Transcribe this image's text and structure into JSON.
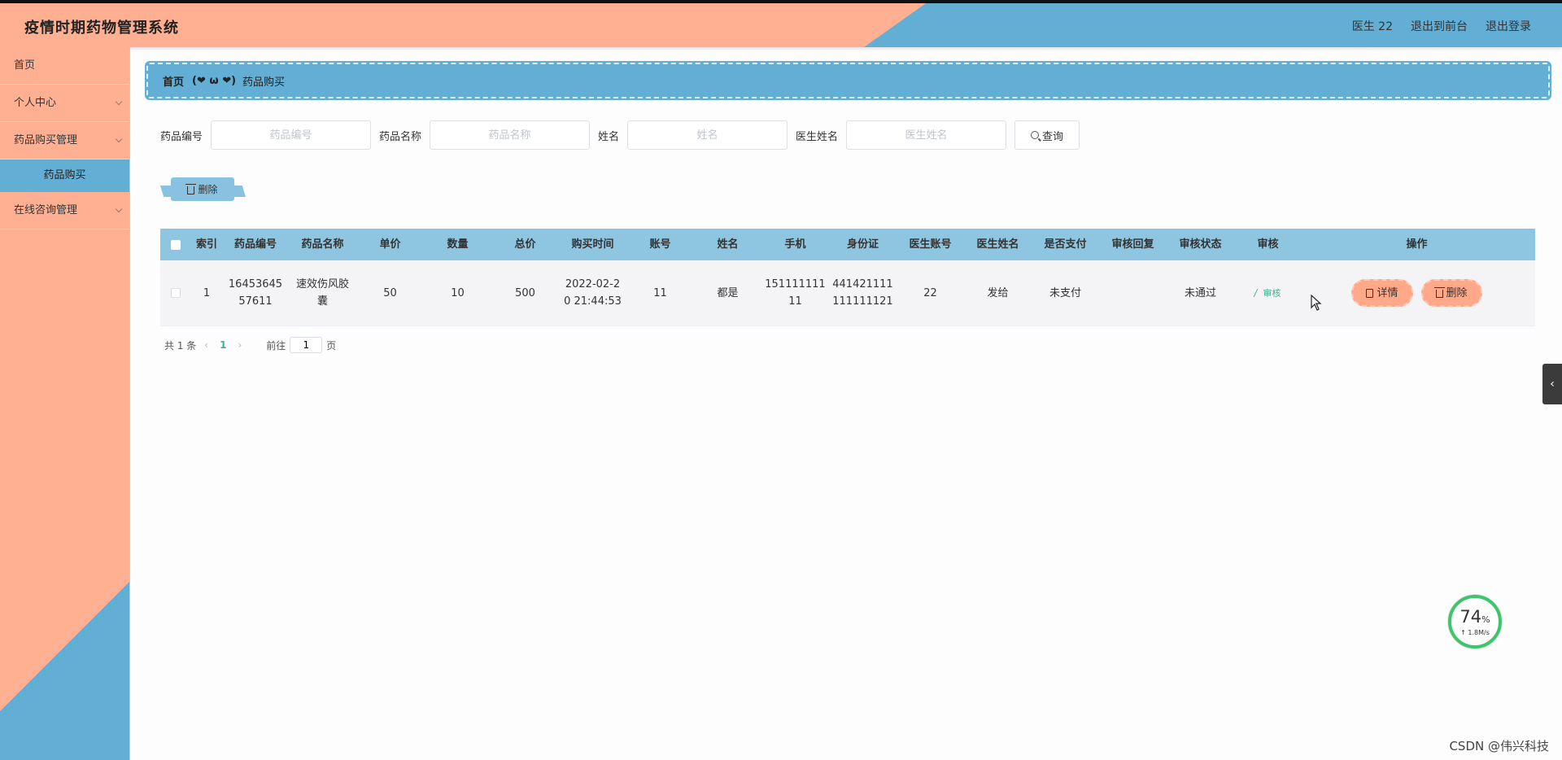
{
  "header": {
    "title": "疫情时期药物管理系统",
    "user": "医生 22",
    "back_front": "退出到前台",
    "logout": "退出登录"
  },
  "sidebar": {
    "items": [
      {
        "label": "首页"
      },
      {
        "label": "个人中心"
      },
      {
        "label": "药品购买管理"
      },
      {
        "label": "药品购买"
      },
      {
        "label": "在线咨询管理"
      }
    ]
  },
  "breadcrumb": {
    "home": "首页",
    "emoji": "(❤ ω ❤)",
    "current": "药品购买"
  },
  "search": {
    "fields": [
      {
        "label": "药品编号",
        "placeholder": "药品编号"
      },
      {
        "label": "药品名称",
        "placeholder": "药品名称"
      },
      {
        "label": "姓名",
        "placeholder": "姓名"
      },
      {
        "label": "医生姓名",
        "placeholder": "医生姓名"
      }
    ],
    "button": "查询"
  },
  "batch_delete": "删除",
  "table": {
    "headers": [
      "索引",
      "药品编号",
      "药品名称",
      "单价",
      "数量",
      "总价",
      "购买时间",
      "账号",
      "姓名",
      "手机",
      "身份证",
      "医生账号",
      "医生姓名",
      "是否支付",
      "审核回复",
      "审核状态",
      "审核",
      "操作"
    ],
    "rows": [
      {
        "index": "1",
        "drug_no": "1645364557611",
        "drug_name": "速效伤风胶囊",
        "price": "50",
        "qty": "10",
        "total": "500",
        "time": "2022-02-20 21:44:53",
        "account": "11",
        "name": "都是",
        "phone": "15111111111",
        "id_card": "441421111111111121",
        "doctor_account": "22",
        "doctor_name": "发给",
        "paid": "未支付",
        "reply": "",
        "status": "未通过",
        "audit": "审核",
        "detail": "详情",
        "delete": "删除"
      }
    ]
  },
  "pagination": {
    "total": "共 1 条",
    "current": "1",
    "goto": "前往",
    "page_value": "1",
    "page_suffix": "页"
  },
  "speed": {
    "percent": "74",
    "percent_unit": "%",
    "rate": "↑ 1.8M/s"
  },
  "watermark": "CSDN @伟兴科技"
}
